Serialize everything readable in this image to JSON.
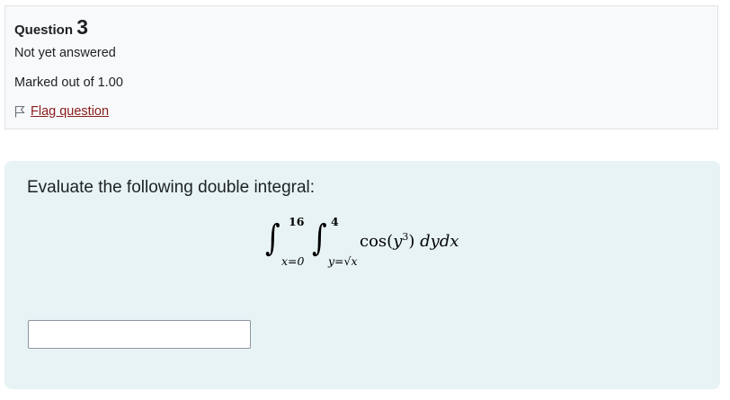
{
  "question": {
    "label": "Question",
    "number": "3",
    "state": "Not yet answered",
    "grade": "Marked out of 1.00",
    "flag_label": "Flag question",
    "flag_icon": "flag-icon"
  },
  "content": {
    "text": "Evaluate the following double integral:",
    "math": {
      "outer_upper": "16",
      "outer_lower": "x=0",
      "inner_upper": "4",
      "inner_lower": "y=√x",
      "cos": "cos",
      "open_paren": "(",
      "base": "y",
      "exponent": "3",
      "close_paren": ")",
      "differentials": "dydx"
    },
    "answer_value": ""
  }
}
